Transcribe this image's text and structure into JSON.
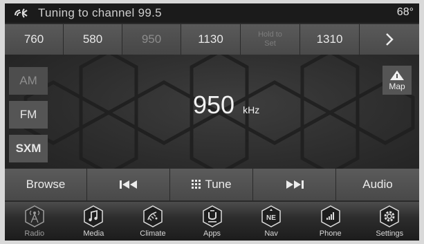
{
  "status_bar": {
    "message": "Tuning to channel 99.5",
    "temperature": "68°"
  },
  "presets": [
    {
      "label": "760"
    },
    {
      "label": "580"
    },
    {
      "label": "950"
    },
    {
      "label": "1130"
    },
    {
      "label": "Hold to Set"
    },
    {
      "label": "1310"
    }
  ],
  "bands": {
    "am": "AM",
    "fm": "FM",
    "sxm": "SXM"
  },
  "map_button": {
    "label": "Map"
  },
  "now_playing": {
    "frequency": "950",
    "unit": "kHz"
  },
  "controls": {
    "browse": "Browse",
    "tune": "Tune",
    "audio": "Audio"
  },
  "dock": [
    {
      "label": "Radio",
      "icon": "radio-icon"
    },
    {
      "label": "Media",
      "icon": "media-icon"
    },
    {
      "label": "Climate",
      "icon": "climate-icon"
    },
    {
      "label": "Apps",
      "icon": "apps-icon"
    },
    {
      "label": "Nav",
      "icon": "nav-icon",
      "badge": "NE"
    },
    {
      "label": "Phone",
      "icon": "phone-icon"
    },
    {
      "label": "Settings",
      "icon": "settings-icon"
    }
  ]
}
